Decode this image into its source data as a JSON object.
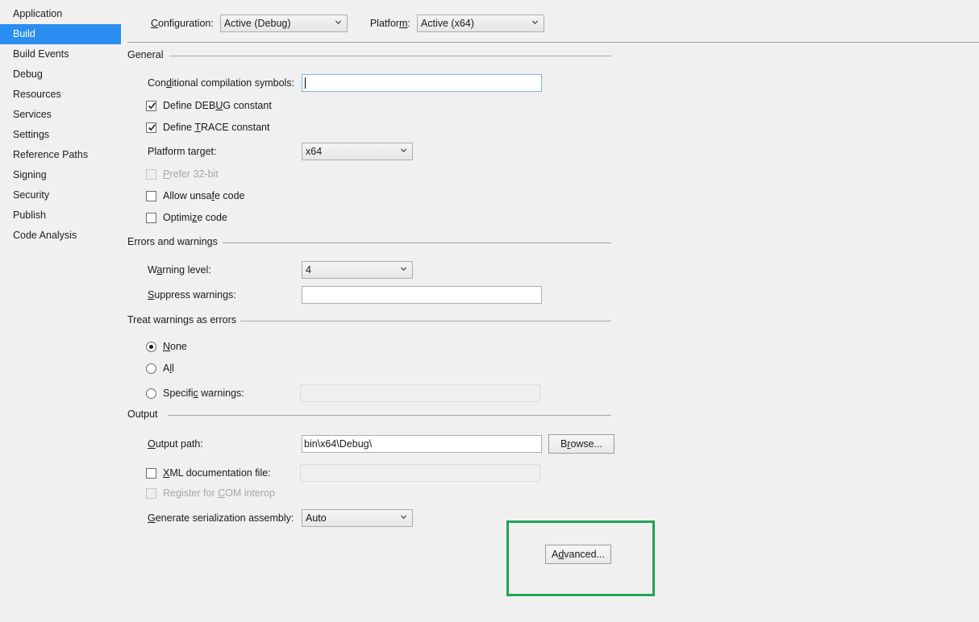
{
  "sidebar": {
    "items": [
      {
        "label": "Application",
        "selected": false
      },
      {
        "label": "Build",
        "selected": true
      },
      {
        "label": "Build Events",
        "selected": false
      },
      {
        "label": "Debug",
        "selected": false
      },
      {
        "label": "Resources",
        "selected": false
      },
      {
        "label": "Services",
        "selected": false
      },
      {
        "label": "Settings",
        "selected": false
      },
      {
        "label": "Reference Paths",
        "selected": false
      },
      {
        "label": "Signing",
        "selected": false
      },
      {
        "label": "Security",
        "selected": false
      },
      {
        "label": "Publish",
        "selected": false
      },
      {
        "label": "Code Analysis",
        "selected": false
      }
    ],
    "selected_color": "#2a8ef0"
  },
  "topbar": {
    "configuration_label": "Configuration:",
    "configuration_value": "Active (Debug)",
    "platform_label": "Platform:",
    "platform_value": "Active (x64)"
  },
  "general": {
    "header": "General",
    "conditional_symbols_label": "Conditional compilation symbols:",
    "conditional_symbols_value": "",
    "define_debug_label": "Define DEBUG constant",
    "define_debug_checked": true,
    "define_trace_label": "Define TRACE constant",
    "define_trace_checked": true,
    "platform_target_label": "Platform target:",
    "platform_target_value": "x64",
    "prefer_32bit_label": "Prefer 32-bit",
    "prefer_32bit_checked": false,
    "prefer_32bit_disabled": true,
    "allow_unsafe_label": "Allow unsafe code",
    "allow_unsafe_checked": false,
    "optimize_label": "Optimize code",
    "optimize_checked": false
  },
  "errors_warnings": {
    "header": "Errors and warnings",
    "warning_level_label": "Warning level:",
    "warning_level_value": "4",
    "suppress_warnings_label": "Suppress warnings:",
    "suppress_warnings_value": ""
  },
  "treat_warnings": {
    "header": "Treat warnings as errors",
    "none_label": "None",
    "all_label": "All",
    "specific_label": "Specific warnings:",
    "specific_value": "",
    "selected": "None"
  },
  "output": {
    "header": "Output",
    "output_path_label": "Output path:",
    "output_path_value": "bin\\x64\\Debug\\",
    "browse_label": "Browse...",
    "xml_doc_label": "XML documentation file:",
    "xml_doc_checked": false,
    "xml_doc_value": "",
    "register_com_label": "Register for COM interop",
    "register_com_checked": false,
    "register_com_disabled": true,
    "generate_serialization_label": "Generate serialization assembly:",
    "generate_serialization_value": "Auto",
    "advanced_label": "Advanced..."
  },
  "annotation": {
    "color": "#22a355"
  }
}
